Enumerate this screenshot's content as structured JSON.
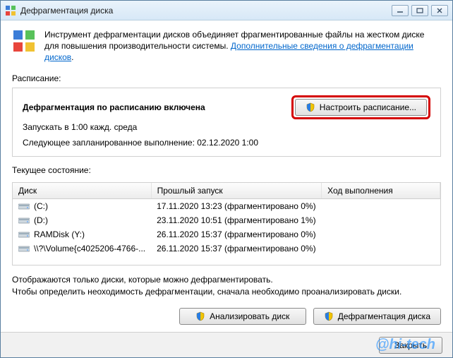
{
  "window": {
    "title": "Дефрагментация диска"
  },
  "intro": {
    "text_before_link": "Инструмент дефрагментации дисков объединяет фрагментированные файлы на жестком диске для повышения производительности системы. ",
    "link_text": "Дополнительные сведения о дефрагментации дисков",
    "text_after_link": "."
  },
  "labels": {
    "schedule": "Расписание:",
    "current_state": "Текущее состояние:"
  },
  "schedule": {
    "enabled_title": "Дефрагментация по расписанию включена",
    "run_at": "Запускать в 1:00 кажд. среда",
    "next_run": "Следующее запланированное выполнение: 02.12.2020 1:00",
    "configure_button": "Настроить расписание..."
  },
  "table": {
    "columns": {
      "disk": "Диск",
      "last_run": "Прошлый запуск",
      "progress": "Ход выполнения"
    },
    "rows": [
      {
        "icon": "hdd",
        "name": "(C:)",
        "last_run": "17.11.2020 13:23 (фрагментировано 0%)",
        "progress": ""
      },
      {
        "icon": "hdd",
        "name": "(D:)",
        "last_run": "23.11.2020 10:51 (фрагментировано 1%)",
        "progress": ""
      },
      {
        "icon": "hdd",
        "name": "RAMDisk (Y:)",
        "last_run": "26.11.2020 15:37 (фрагментировано 0%)",
        "progress": ""
      },
      {
        "icon": "hdd",
        "name": "\\\\?\\Volume{c4025206-4766-...",
        "last_run": "26.11.2020 15:37 (фрагментировано 0%)",
        "progress": ""
      }
    ]
  },
  "info": {
    "line1": "Отображаются только диски, которые можно дефрагментировать.",
    "line2": "Чтобы определить неоходимость  дефрагментации, сначала необходимо проанализировать диски."
  },
  "buttons": {
    "analyze": "Анализировать диск",
    "defrag": "Дефрагментация диска",
    "close": "Закрыть"
  },
  "watermark": "@hi-tech"
}
